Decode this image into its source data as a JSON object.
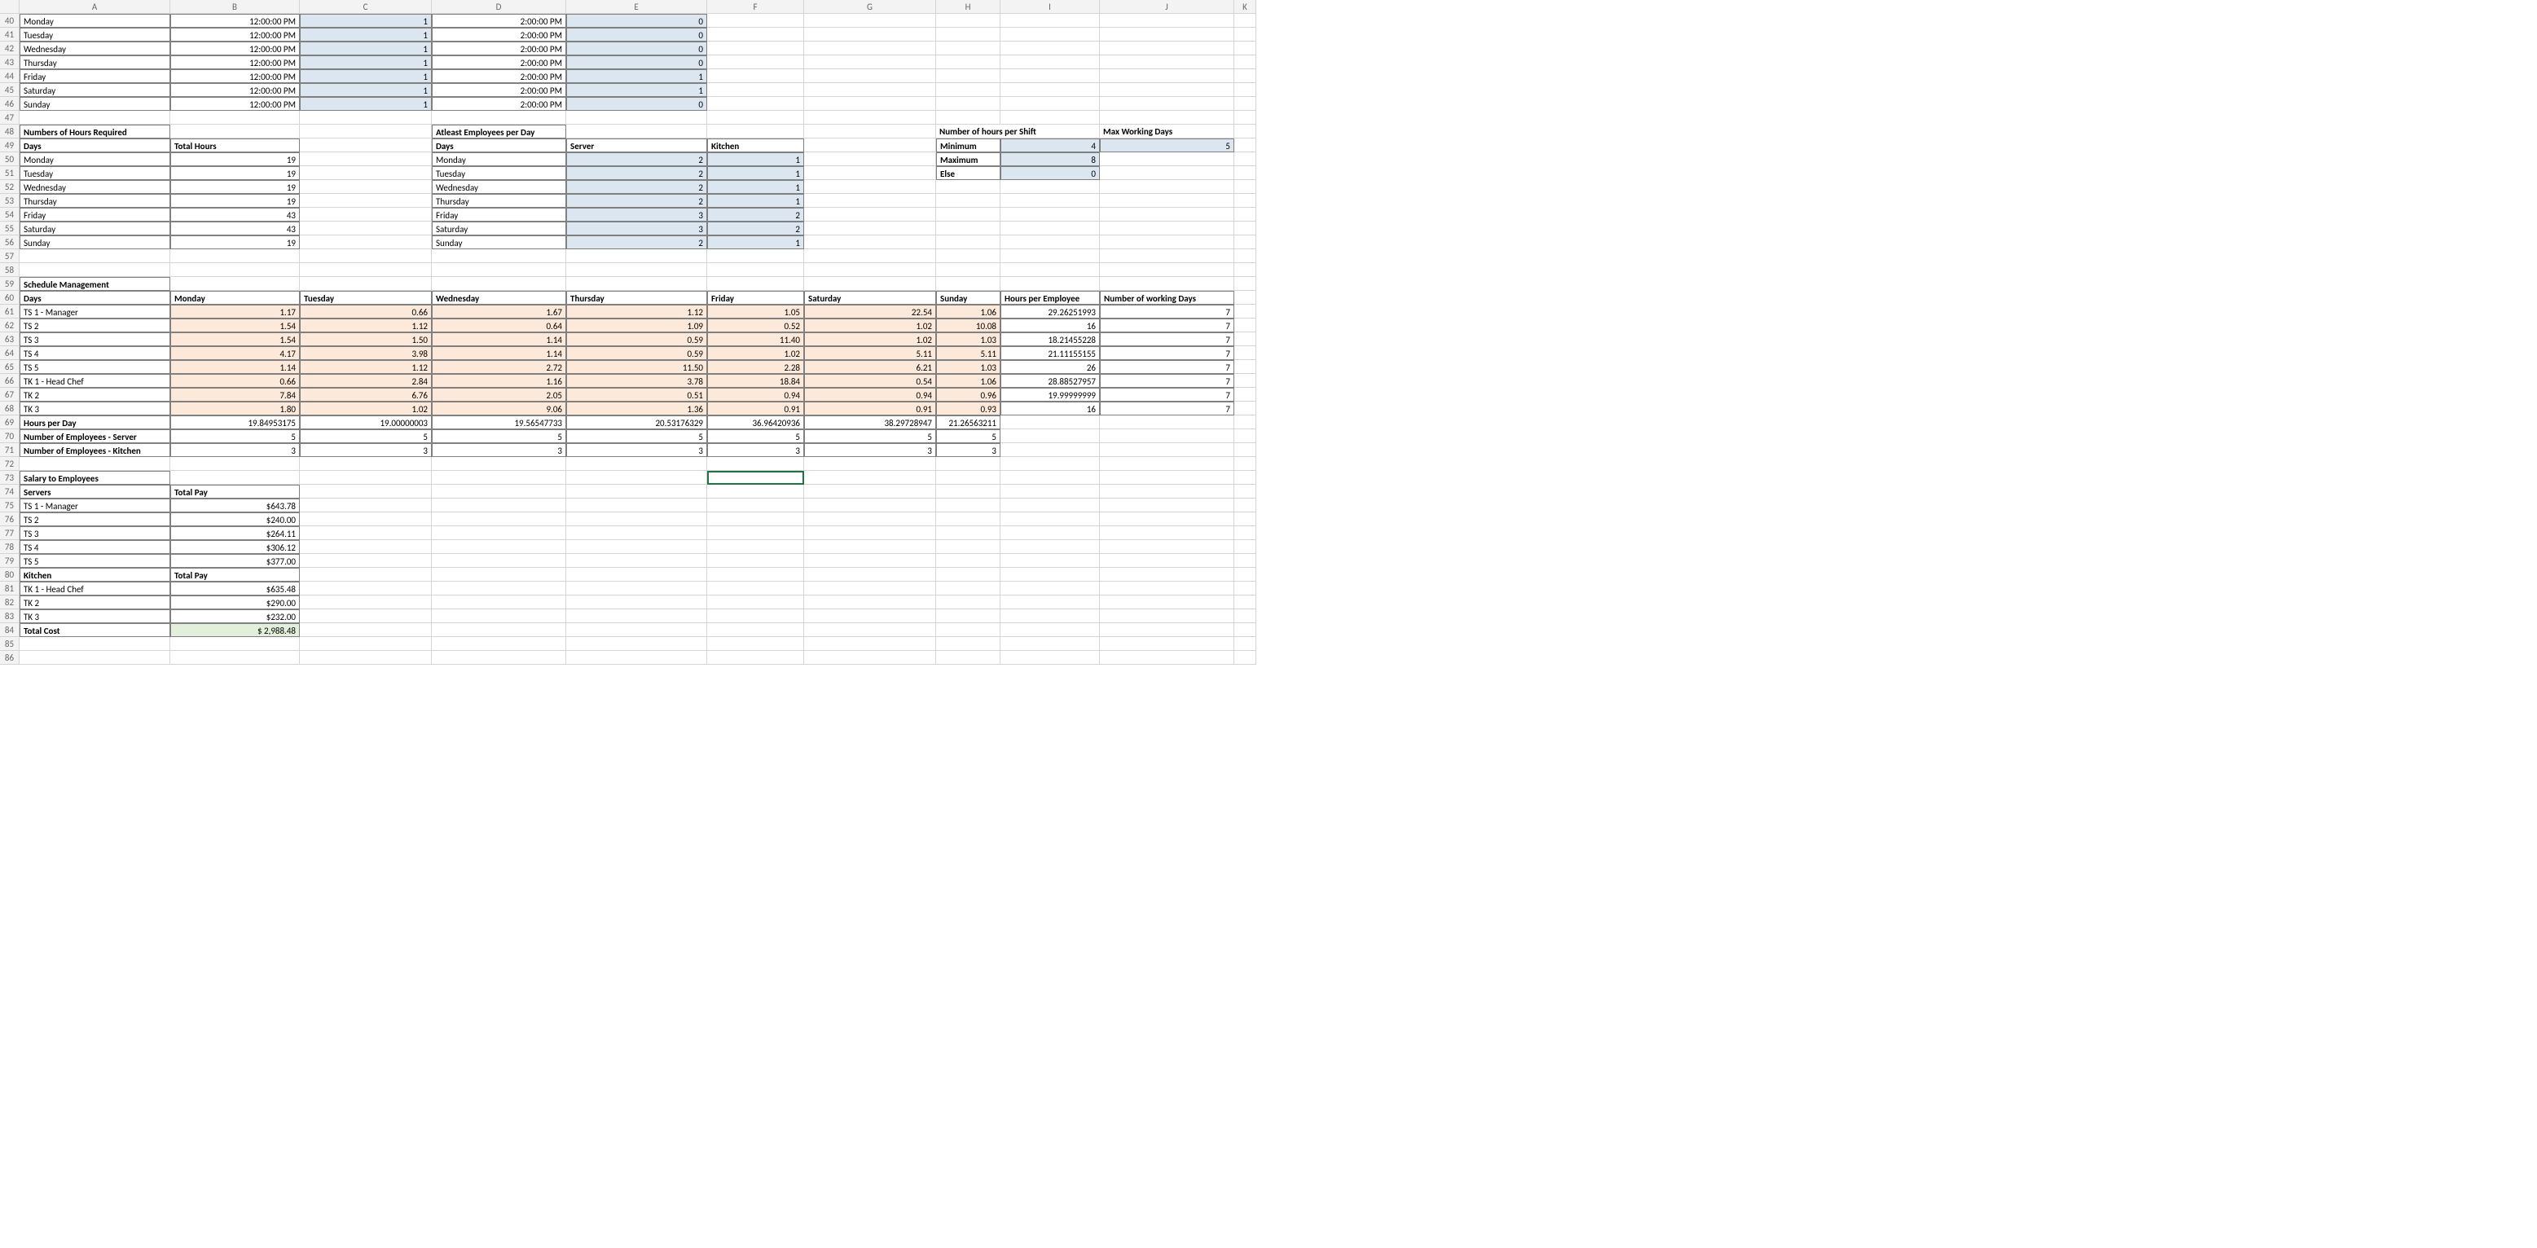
{
  "columns": [
    "",
    "A",
    "B",
    "C",
    "D",
    "E",
    "F",
    "G",
    "H",
    "I",
    "J",
    "K"
  ],
  "firstRow": 40,
  "lastRow": 86,
  "activeCell": {
    "col": "F",
    "row": 73
  },
  "rows": {
    "40": {
      "A": "Monday",
      "B": "12:00:00 PM",
      "C": "1",
      "D": "2:00:00 PM",
      "E": "0",
      "blueC": true,
      "blueE": true
    },
    "41": {
      "A": "Tuesday",
      "B": "12:00:00 PM",
      "C": "1",
      "D": "2:00:00 PM",
      "E": "0",
      "blueC": true,
      "blueE": true
    },
    "42": {
      "A": "Wednesday",
      "B": "12:00:00 PM",
      "C": "1",
      "D": "2:00:00 PM",
      "E": "0",
      "blueC": true,
      "blueE": true
    },
    "43": {
      "A": "Thursday",
      "B": "12:00:00 PM",
      "C": "1",
      "D": "2:00:00 PM",
      "E": "0",
      "blueC": true,
      "blueE": true
    },
    "44": {
      "A": "Friday",
      "B": "12:00:00 PM",
      "C": "1",
      "D": "2:00:00 PM",
      "E": "1",
      "blueC": true,
      "blueE": true
    },
    "45": {
      "A": "Saturday",
      "B": "12:00:00 PM",
      "C": "1",
      "D": "2:00:00 PM",
      "E": "1",
      "blueC": true,
      "blueE": true
    },
    "46": {
      "A": "Sunday",
      "B": "12:00:00 PM",
      "C": "1",
      "D": "2:00:00 PM",
      "E": "0",
      "blueC": true,
      "blueE": true
    }
  },
  "hoursReq": {
    "title": "Numbers of Hours Required",
    "header": {
      "A": "Days",
      "B": "Total Hours"
    },
    "rows": [
      {
        "A": "Monday",
        "B": "19"
      },
      {
        "A": "Tuesday",
        "B": "19"
      },
      {
        "A": "Wednesday",
        "B": "19"
      },
      {
        "A": "Thursday",
        "B": "19"
      },
      {
        "A": "Friday",
        "B": "43"
      },
      {
        "A": "Saturday",
        "B": "43"
      },
      {
        "A": "Sunday",
        "B": "19"
      }
    ]
  },
  "atleast": {
    "title": "Atleast Employees per Day",
    "header": {
      "D": "Days",
      "E": "Server",
      "F": "Kitchen"
    },
    "rows": [
      {
        "D": "Monday",
        "E": "2",
        "F": "1"
      },
      {
        "D": "Tuesday",
        "E": "2",
        "F": "1"
      },
      {
        "D": "Wednesday",
        "E": "2",
        "F": "1"
      },
      {
        "D": "Thursday",
        "E": "2",
        "F": "1"
      },
      {
        "D": "Friday",
        "E": "3",
        "F": "2"
      },
      {
        "D": "Saturday",
        "E": "3",
        "F": "2"
      },
      {
        "D": "Sunday",
        "E": "2",
        "F": "1"
      }
    ]
  },
  "shift": {
    "title": "Number of hours per Shift",
    "min": {
      "label": "Minimum",
      "val": "4"
    },
    "max": {
      "label": "Maximum",
      "val": "8"
    },
    "else": {
      "label": "Else",
      "val": "0"
    }
  },
  "maxwd": {
    "title": "Max Working Days",
    "val": "5"
  },
  "schedTitle": "Schedule Management",
  "schedHdr": {
    "A": "Days",
    "B": "Monday",
    "C": "Tuesday",
    "D": "Wednesday",
    "E": "Thursday",
    "F": "Friday",
    "G": "Saturday",
    "H": "Sunday",
    "I": "Hours per Employee",
    "J": "Number of working Days"
  },
  "sched": [
    {
      "A": "TS 1 - Manager",
      "B": "1.17",
      "C": "0.66",
      "D": "1.67",
      "E": "1.12",
      "F": "1.05",
      "G": "22.54",
      "H": "1.06",
      "I": "29.26251993",
      "J": "7"
    },
    {
      "A": "TS 2",
      "B": "1.54",
      "C": "1.12",
      "D": "0.64",
      "E": "1.09",
      "F": "0.52",
      "G": "1.02",
      "H": "10.08",
      "I": "16",
      "J": "7"
    },
    {
      "A": "TS 3",
      "B": "1.54",
      "C": "1.50",
      "D": "1.14",
      "E": "0.59",
      "F": "11.40",
      "G": "1.02",
      "H": "1.03",
      "I": "18.21455228",
      "J": "7"
    },
    {
      "A": "TS 4",
      "B": "4.17",
      "C": "3.98",
      "D": "1.14",
      "E": "0.59",
      "F": "1.02",
      "G": "5.11",
      "H": "5.11",
      "I": "21.11155155",
      "J": "7"
    },
    {
      "A": "TS 5",
      "B": "1.14",
      "C": "1.12",
      "D": "2.72",
      "E": "11.50",
      "F": "2.28",
      "G": "6.21",
      "H": "1.03",
      "I": "26",
      "J": "7"
    },
    {
      "A": "TK 1 - Head Chef",
      "B": "0.66",
      "C": "2.84",
      "D": "1.16",
      "E": "3.78",
      "F": "18.84",
      "G": "0.54",
      "H": "1.06",
      "I": "28.88527957",
      "J": "7"
    },
    {
      "A": "TK 2",
      "B": "7.84",
      "C": "6.76",
      "D": "2.05",
      "E": "0.51",
      "F": "0.94",
      "G": "0.94",
      "H": "0.96",
      "I": "19.99999999",
      "J": "7"
    },
    {
      "A": "TK 3",
      "B": "1.80",
      "C": "1.02",
      "D": "9.06",
      "E": "1.36",
      "F": "0.91",
      "G": "0.91",
      "H": "0.93",
      "I": "16",
      "J": "7"
    }
  ],
  "hpd": {
    "A": "Hours per Day",
    "B": "19.84953175",
    "C": "19.00000003",
    "D": "19.56547733",
    "E": "20.53176329",
    "F": "36.96420936",
    "G": "38.29728947",
    "H": "21.26563211"
  },
  "empServer": {
    "A": "Number of Employees - Server",
    "B": "5",
    "C": "5",
    "D": "5",
    "E": "5",
    "F": "5",
    "G": "5",
    "H": "5"
  },
  "empKitchen": {
    "A": "Number of Employees - Kitchen",
    "B": "3",
    "C": "3",
    "D": "3",
    "E": "3",
    "F": "3",
    "G": "3",
    "H": "3"
  },
  "salaryTitle": "Salary to Employees",
  "salaryServersHdr": {
    "A": "Servers",
    "B": "Total Pay"
  },
  "salariesS": [
    {
      "A": "TS 1 - Manager",
      "B": "$643.78"
    },
    {
      "A": "TS 2",
      "B": "$240.00"
    },
    {
      "A": "TS 3",
      "B": "$264.11"
    },
    {
      "A": "TS 4",
      "B": "$306.12"
    },
    {
      "A": "TS 5",
      "B": "$377.00"
    }
  ],
  "salaryKitchenHdr": {
    "A": "Kitchen",
    "B": "Total Pay"
  },
  "salariesK": [
    {
      "A": "TK 1 - Head Chef",
      "B": "$635.48"
    },
    {
      "A": "TK 2",
      "B": "$290.00"
    },
    {
      "A": "TK 3",
      "B": "$232.00"
    }
  ],
  "totalCost": {
    "A": "Total Cost",
    "B": "$             2,988.48"
  }
}
